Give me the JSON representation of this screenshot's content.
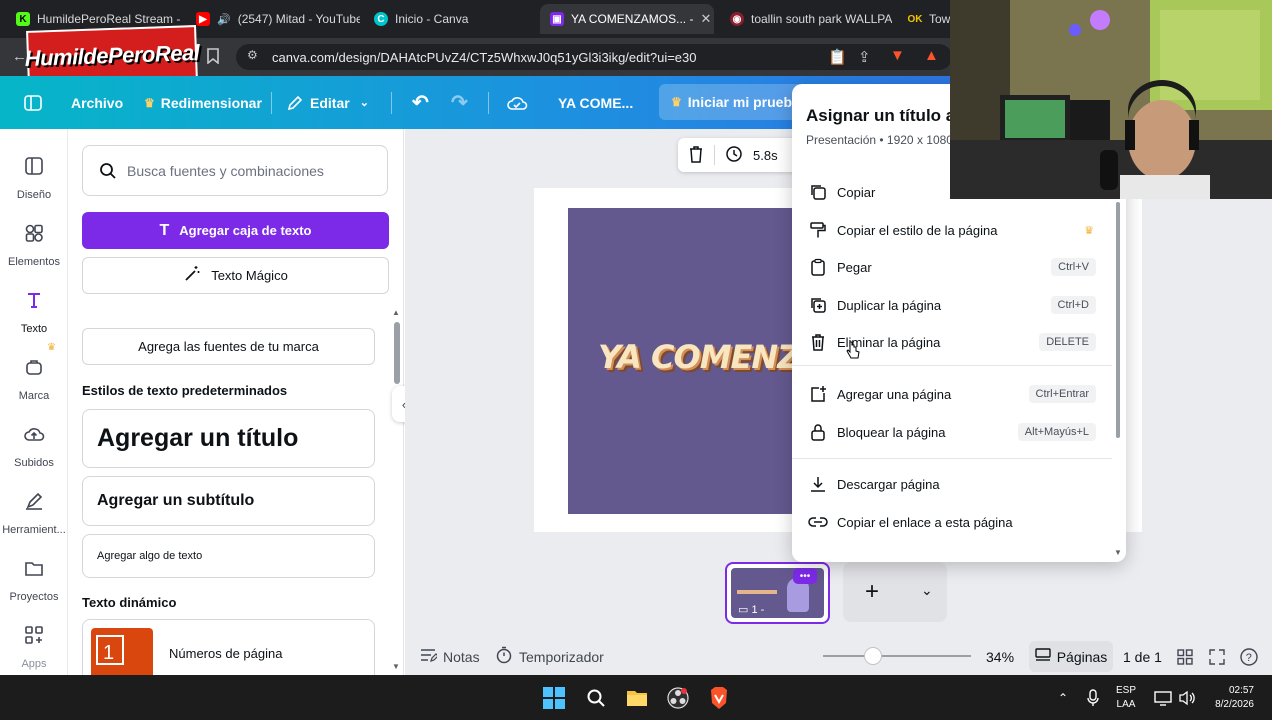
{
  "browser": {
    "tabs": [
      {
        "title": "HumildePeroReal Stream -",
        "active": false
      },
      {
        "title": "(2547) Mitad - YouTube",
        "active": false
      },
      {
        "title": "Inicio - Canva",
        "active": false
      },
      {
        "title": "YA COMENZAMOS... -",
        "active": true
      },
      {
        "title": "toallin south park WALLPA",
        "active": false
      },
      {
        "title": "Tow",
        "active": false
      }
    ],
    "url": "canva.com/design/DAHAtcPUvZ4/CTz5WhxwJ0q51yGl3i3ikg/edit?ui=e30",
    "logo_text": "HumildePeroReal"
  },
  "toolbar": {
    "archivo": "Archivo",
    "redimensionar": "Redimensionar",
    "editar": "Editar",
    "design_title": "YA COME...",
    "upgrade": "Iniciar mi prueb."
  },
  "rail": [
    {
      "label": "Diseño",
      "icon": "layout-icon"
    },
    {
      "label": "Elementos",
      "icon": "shapes-icon"
    },
    {
      "label": "Texto",
      "icon": "text-icon"
    },
    {
      "label": "Marca",
      "icon": "brand-icon"
    },
    {
      "label": "Subidos",
      "icon": "cloud-upload-icon"
    },
    {
      "label": "Herramient...",
      "icon": "tools-icon"
    },
    {
      "label": "Proyectos",
      "icon": "folder-icon"
    },
    {
      "label": "Apps",
      "icon": "apps-icon"
    }
  ],
  "panel": {
    "search_placeholder": "Busca fuentes y combinaciones",
    "add_text_box": "Agregar caja de texto",
    "magic_text": "Texto Mágico",
    "brand_fonts": "Agrega las fuentes de tu marca",
    "default_styles_heading": "Estilos de texto predeterminados",
    "add_title": "Agregar un título",
    "add_subtitle": "Agregar un subtítulo",
    "add_body": "Agregar algo de texto",
    "dynamic_heading": "Texto dinámico",
    "page_numbers": "Números de página"
  },
  "canvas": {
    "duration": "5.8s",
    "slide_text": "YA COMENZAMOS",
    "slide_color": "#64598f",
    "thumb_number": "1 -"
  },
  "context_menu": {
    "title": "Asignar un título a",
    "subtitle": "Presentación • 1920 x 1080",
    "items": [
      {
        "label": "Copiar",
        "shortcut": "",
        "icon": "copy-icon"
      },
      {
        "label": "Copiar el estilo de la página",
        "shortcut": "",
        "icon": "paint-roller-icon",
        "premium": true
      },
      {
        "label": "Pegar",
        "shortcut": "Ctrl+V",
        "icon": "clipboard-icon"
      },
      {
        "label": "Duplicar la página",
        "shortcut": "Ctrl+D",
        "icon": "duplicate-icon"
      },
      {
        "label": "Eliminar la página",
        "shortcut": "DELETE",
        "icon": "trash-icon"
      },
      {
        "label": "Agregar una página",
        "shortcut": "Ctrl+Entrar",
        "icon": "add-page-icon"
      },
      {
        "label": "Bloquear la página",
        "shortcut": "Alt+Mayús+L",
        "icon": "lock-icon"
      },
      {
        "label": "Descargar página",
        "shortcut": "",
        "icon": "download-icon"
      },
      {
        "label": "Copiar el enlace a esta página",
        "shortcut": "",
        "icon": "link-icon"
      }
    ]
  },
  "bottom": {
    "notes": "Notas",
    "timer": "Temporizador",
    "zoom": "34%",
    "pages": "Páginas",
    "page_count": "1 de 1"
  },
  "taskbar": {
    "lang_line1": "ESP",
    "lang_line2": "LAA",
    "time": "02:57",
    "date": "8/2/2026"
  },
  "colors": {
    "accent": "#7d2ae8",
    "toolbar_start": "#06b6c8",
    "toolbar_end": "#3b5fe6"
  }
}
